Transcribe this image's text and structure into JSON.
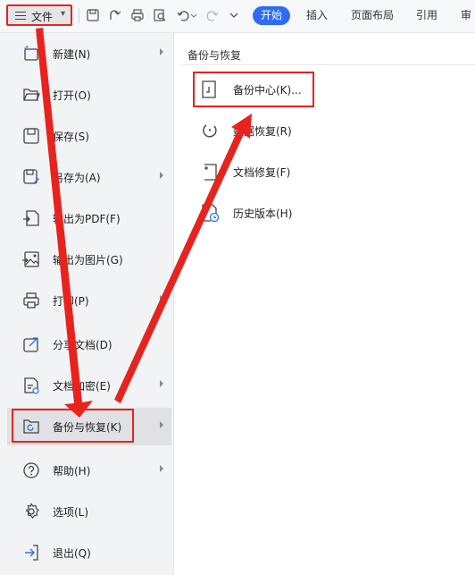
{
  "toolbar": {
    "file_label": "文件",
    "tabs": [
      "开始",
      "插入",
      "页面布局",
      "引用",
      "审"
    ],
    "active_tab": "开始"
  },
  "menu": {
    "items": [
      {
        "label": "新建(N)",
        "icon": "new-icon",
        "has_submenu": true
      },
      {
        "label": "打开(O)",
        "icon": "folder-open-icon",
        "has_submenu": false
      },
      {
        "label": "保存(S)",
        "icon": "save-icon",
        "has_submenu": false
      },
      {
        "label": "另存为(A)",
        "icon": "save-as-icon",
        "has_submenu": true
      },
      {
        "label": "输出为PDF(F)",
        "icon": "export-pdf-icon",
        "has_submenu": false
      },
      {
        "label": "输出为图片(G)",
        "icon": "export-image-icon",
        "has_submenu": false
      },
      {
        "label": "打印(P)",
        "icon": "print-icon",
        "has_submenu": true
      },
      {
        "label": "分享文档(D)",
        "icon": "share-icon",
        "has_submenu": false
      },
      {
        "label": "文档加密(E)",
        "icon": "encrypt-icon",
        "has_submenu": true
      },
      {
        "label": "备份与恢复(K)",
        "icon": "backup-restore-icon",
        "has_submenu": true,
        "active": true
      },
      {
        "label": "帮助(H)",
        "icon": "help-icon",
        "has_submenu": true
      },
      {
        "label": "选项(L)",
        "icon": "settings-icon",
        "has_submenu": false
      },
      {
        "label": "退出(Q)",
        "icon": "exit-icon",
        "has_submenu": false
      }
    ]
  },
  "submenu": {
    "title": "备份与恢复",
    "items": [
      {
        "label": "备份中心(K)...",
        "icon": "backup-center-icon"
      },
      {
        "label": "数据恢复(R)",
        "icon": "data-recovery-icon"
      },
      {
        "label": "文档修复(F)",
        "icon": "document-repair-icon"
      },
      {
        "label": "历史版本(H)",
        "icon": "history-version-icon"
      }
    ]
  },
  "colors": {
    "accent": "#2e6cf6",
    "annotation": "#e8231e"
  }
}
